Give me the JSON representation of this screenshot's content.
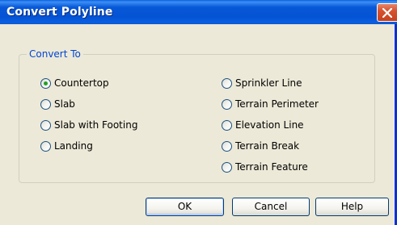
{
  "window": {
    "title": "Convert Polyline",
    "close_icon": "close-icon",
    "colors": {
      "titlebar": "#0453d4",
      "face": "#ece9d8",
      "close": "#d6532f",
      "group_label": "#0046d5",
      "radio_dot": "#21a121"
    }
  },
  "group": {
    "label": "Convert To",
    "options_left": [
      {
        "label": "Countertop",
        "checked": true
      },
      {
        "label": "Slab",
        "checked": false
      },
      {
        "label": "Slab with Footing",
        "checked": false
      },
      {
        "label": "Landing",
        "checked": false
      }
    ],
    "options_right": [
      {
        "label": "Sprinkler Line",
        "checked": false
      },
      {
        "label": "Terrain Perimeter",
        "checked": false
      },
      {
        "label": "Elevation Line",
        "checked": false
      },
      {
        "label": "Terrain Break",
        "checked": false
      },
      {
        "label": "Terrain Feature",
        "checked": false
      }
    ]
  },
  "buttons": {
    "ok": "OK",
    "cancel": "Cancel",
    "help": "Help"
  }
}
